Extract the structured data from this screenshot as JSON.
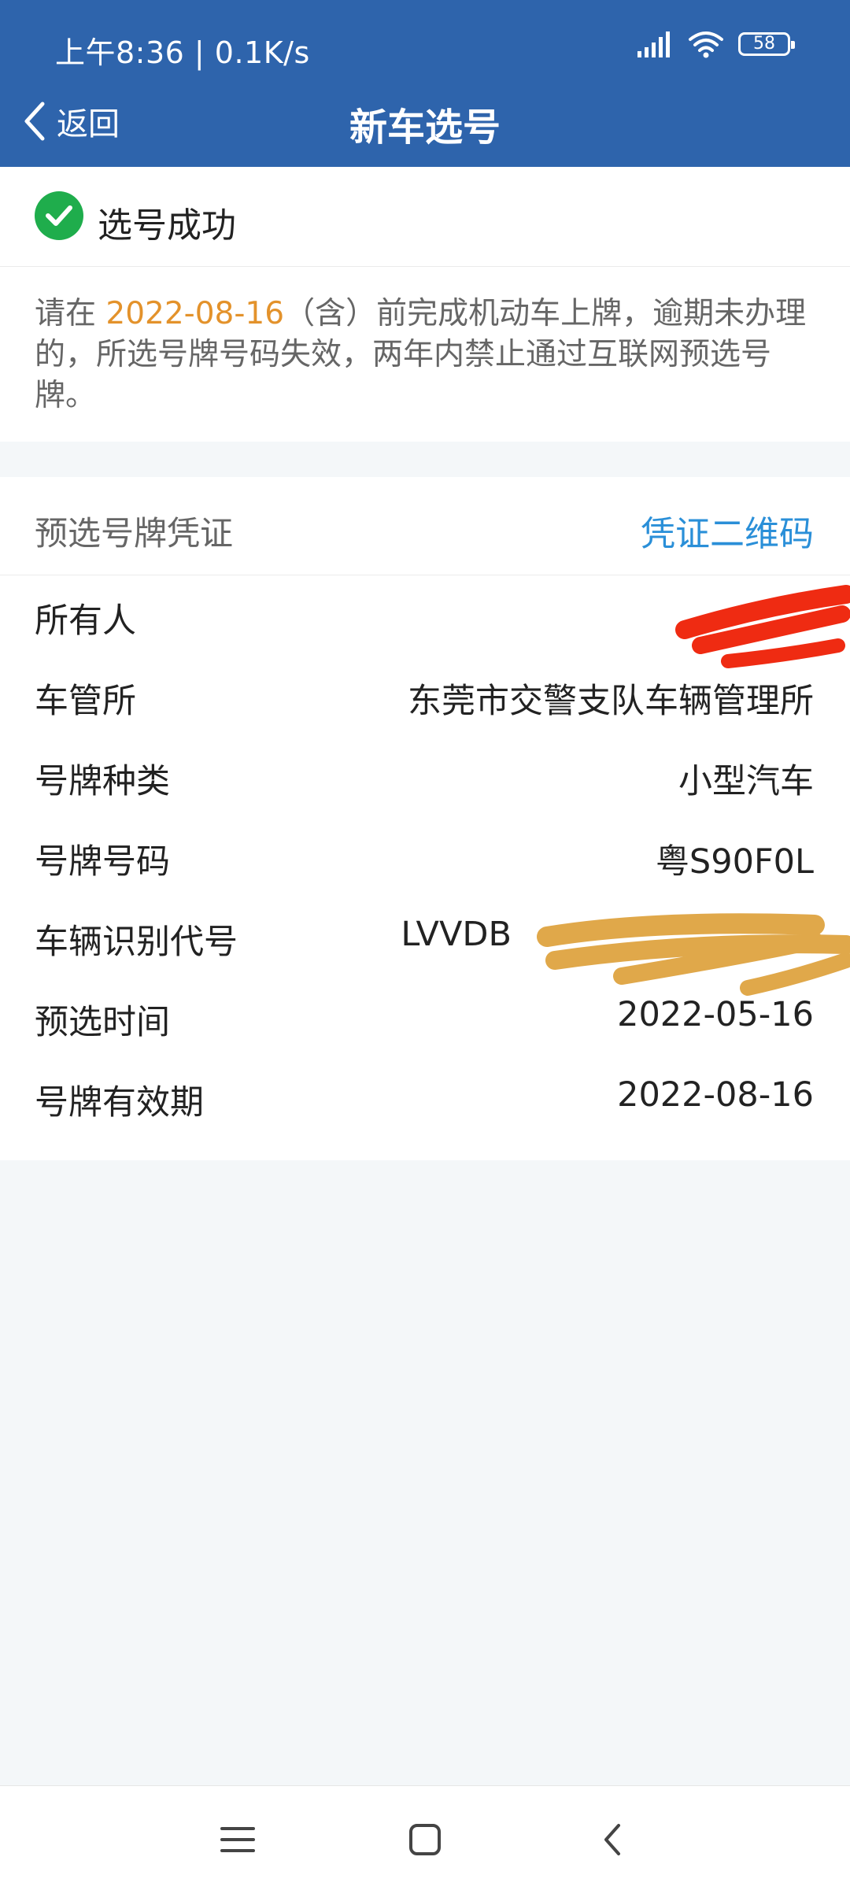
{
  "status_bar": {
    "time": "上午8:36 | 0.1K/s",
    "battery": "58",
    "icons": [
      "signal-icon",
      "wifi-icon",
      "battery-icon"
    ]
  },
  "nav": {
    "back_label": "返回",
    "title": "新车选号"
  },
  "success": {
    "title": "选号成功"
  },
  "notice": {
    "prefix": "请在 ",
    "date": "2022-08-16",
    "suffix": "（含）前完成机动车上牌，逾期未办理的，所选号牌号码失效，两年内禁止通过互联网预选号牌。"
  },
  "voucher": {
    "title": "预选号牌凭证",
    "qr_link": "凭证二维码",
    "rows": [
      {
        "label": "所有人",
        "value": ""
      },
      {
        "label": "车管所",
        "value": "东莞市交警支队车辆管理所"
      },
      {
        "label": "号牌种类",
        "value": "小型汽车"
      },
      {
        "label": "号牌号码",
        "value": "粤S90F0L"
      },
      {
        "label": "车辆识别代号",
        "value": "LVVDB"
      },
      {
        "label": "预选时间",
        "value": "2022-05-16"
      },
      {
        "label": "号牌有效期",
        "value": "2022-08-16"
      }
    ]
  },
  "colors": {
    "header": "#2e64ac",
    "accent_orange": "#e3922b",
    "link_blue": "#2a8fd8",
    "success_green": "#1fad4c"
  }
}
